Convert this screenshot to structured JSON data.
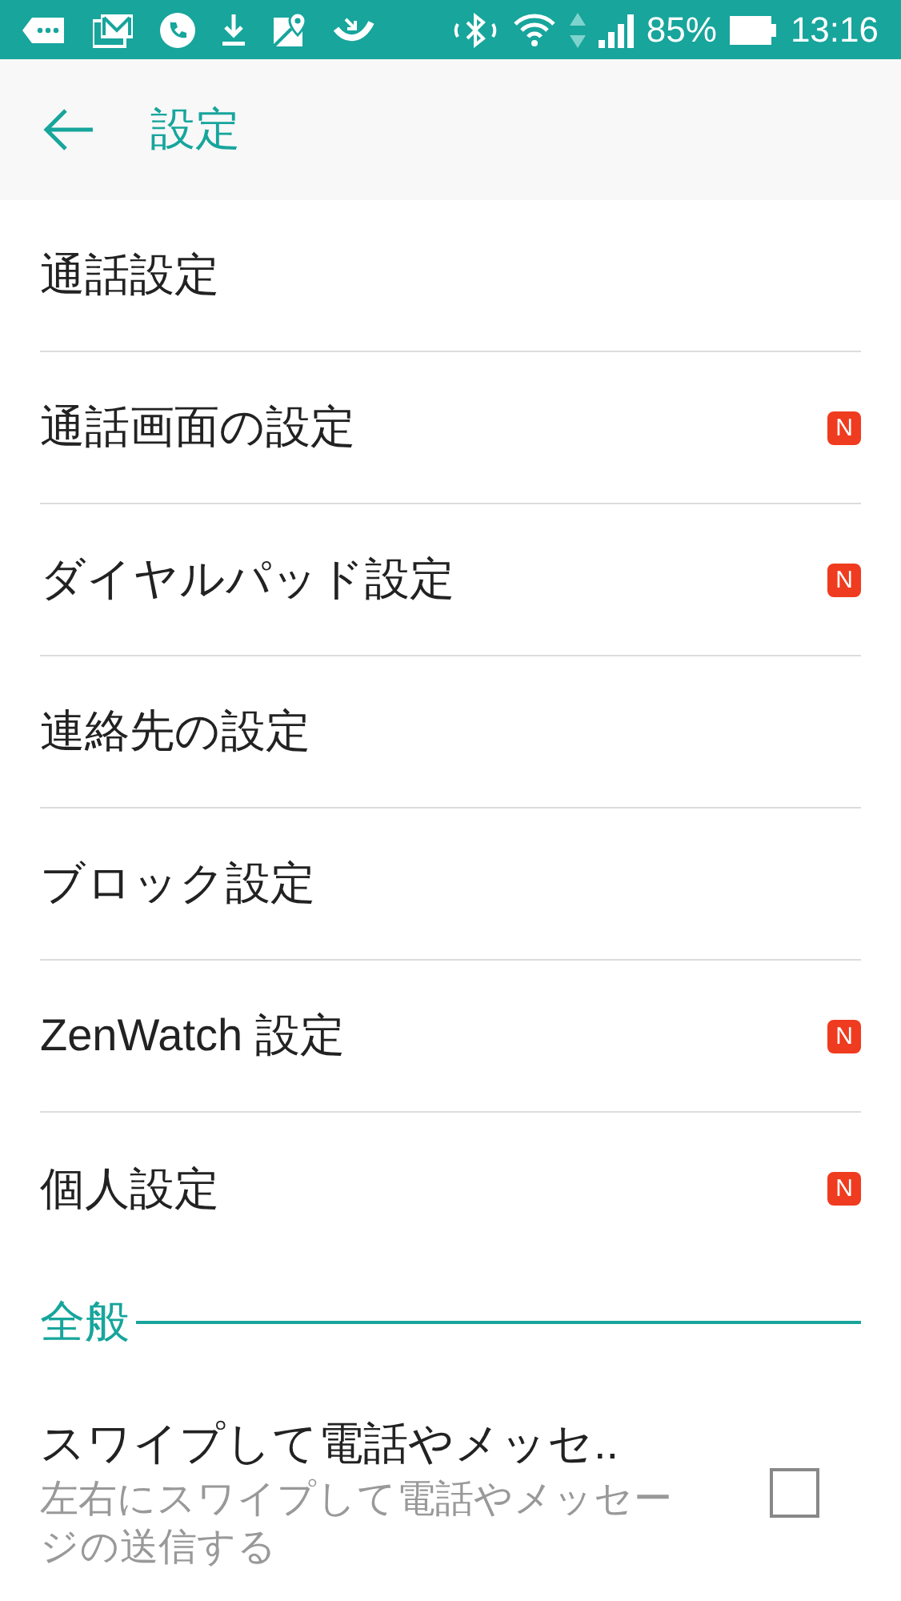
{
  "status_bar": {
    "battery": "85%",
    "time": "13:16"
  },
  "header": {
    "title": "設定"
  },
  "items": [
    {
      "label": "通話設定"
    },
    {
      "label": "通話画面の設定",
      "badge": "N"
    },
    {
      "label": "ダイヤルパッド設定",
      "badge": "N"
    },
    {
      "label": "連絡先の設定"
    },
    {
      "label": "ブロック設定"
    },
    {
      "label": "ZenWatch 設定",
      "badge": "N"
    },
    {
      "label": "個人設定",
      "badge": "N"
    }
  ],
  "section": {
    "title": "全般",
    "items": [
      {
        "title": "スワイプして電話やメッセ..",
        "subtitle": "左右にスワイプして電話やメッセージの送信する",
        "checked": false
      }
    ]
  }
}
